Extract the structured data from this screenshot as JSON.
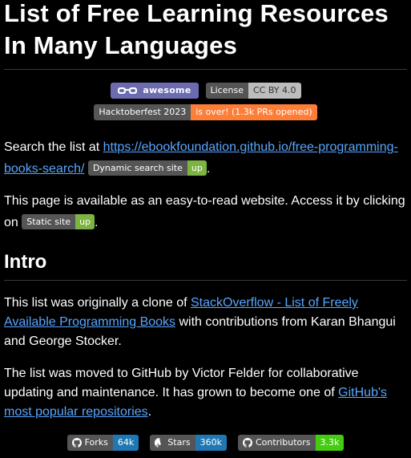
{
  "title": {
    "line1": "List of Free Learning Resources",
    "line2": "In Many Languages"
  },
  "badges_top": {
    "awesome": {
      "label": "awesome",
      "icon": "glasses-icon",
      "color": "#6c6bb0"
    },
    "license": {
      "left": "License",
      "right": "CC BY 4.0",
      "right_color": "#d1d1d1"
    },
    "hacktoberfest": {
      "left": "Hacktoberfest 2023",
      "right": "is over! (1.3k PRs opened)",
      "right_color": "#ff8c42"
    }
  },
  "search": {
    "prefix": "Search the list at ",
    "url": "https://ebookfoundation.github.io/free-programming-books-search/",
    "url_line1": "https://ebookfoundation.github.io/free-programming-",
    "url_line2": "books-search/",
    "badge_left": "Dynamic search site",
    "badge_right": "up",
    "suffix": "."
  },
  "easy_read": {
    "text_line1": "This page is available as an easy-to-read website. Access it by clicking",
    "text_on": "on ",
    "badge_left": "Static site",
    "badge_right": "up",
    "suffix": "."
  },
  "intro": {
    "heading": "Intro",
    "p1_prefix": "This list was originally a clone of ",
    "p1_link": "StackOverflow - List of Freely Available Programming Books",
    "p1_link_line1": "StackOverflow - List of Freely",
    "p1_link_line2": "Available Programming Books",
    "p1_suffix": " with contributions from Karan Bhangui",
    "p1_suffix2": "and George Stocker.",
    "p2_line1": "The list was moved to GitHub by Victor Felder for collaborative",
    "p2_line2_prefix": "updating and maintenance. It has grown to become one of ",
    "p2_link_line1": "GitHub's",
    "p2_link_line2": "most popular repositories",
    "p2_suffix": "."
  },
  "badges_bottom": {
    "forks": {
      "left": "Forks",
      "right": "64k",
      "right_color": "#1f78b4"
    },
    "stars": {
      "left": "Stars",
      "right": "360k",
      "right_color": "#1f78b4"
    },
    "contributors": {
      "left": "Contributors",
      "right": "3.3k",
      "right_color": "#44cc11"
    }
  },
  "colors": {
    "link": "#58a6ff",
    "background": "#000000",
    "badge_dark": "#555555",
    "badge_up": "#7cb342"
  }
}
